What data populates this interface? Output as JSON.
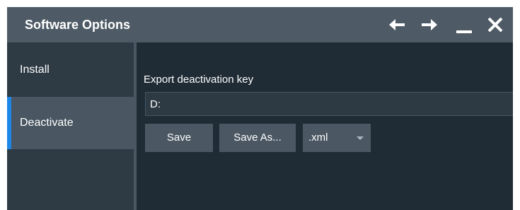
{
  "window": {
    "title": "Software Options",
    "controls": [
      {
        "name": "back-arrow-icon"
      },
      {
        "name": "forward-arrow-icon"
      },
      {
        "name": "minimize-icon"
      },
      {
        "name": "close-icon"
      }
    ]
  },
  "sidebar": {
    "items": [
      {
        "label": "Install",
        "active": false
      },
      {
        "label": "Deactivate",
        "active": true
      }
    ]
  },
  "main": {
    "field_label": "Export deactivation key",
    "path_value": "D:",
    "save_label": "Save",
    "save_as_label": "Save As...",
    "format_value": ".xml"
  },
  "colors": {
    "titlebar": "#4e5b66",
    "background": "#202c35",
    "sidebar": "#2e3b45",
    "accent": "#1b87e6",
    "button": "#4b5863"
  }
}
